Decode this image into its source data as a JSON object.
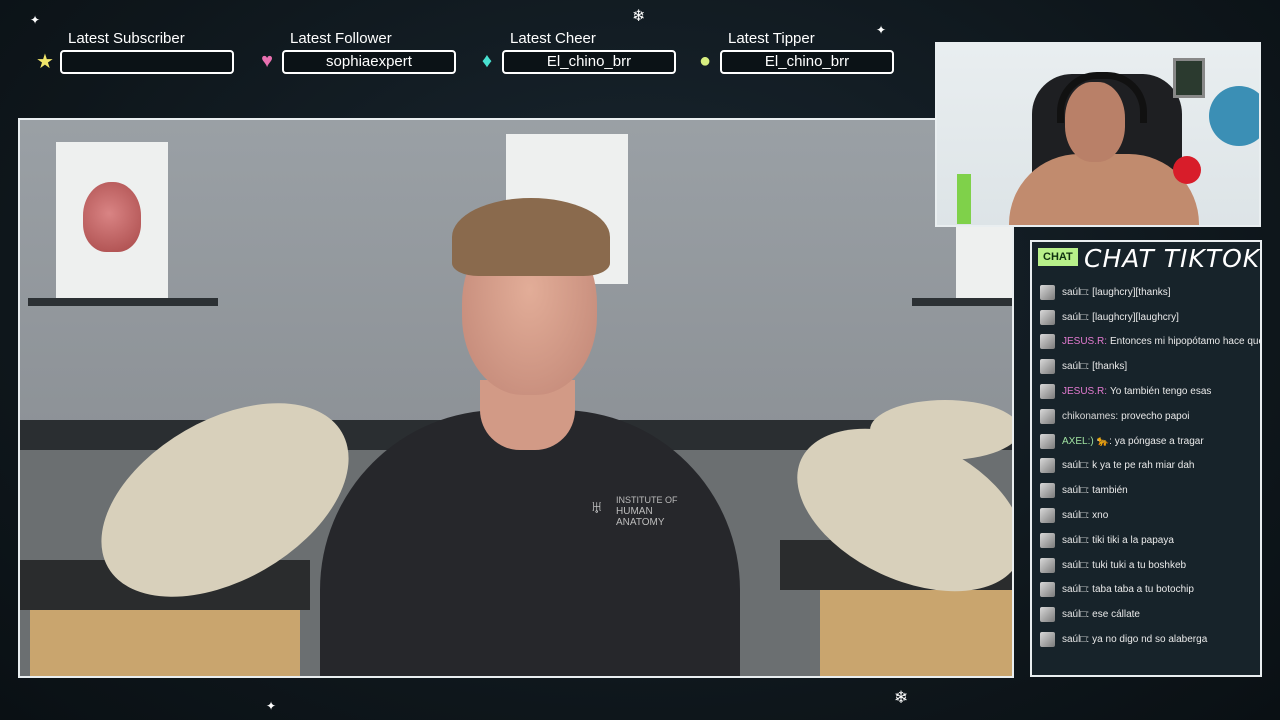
{
  "stats": [
    {
      "label": "Latest Subscriber",
      "value": "",
      "icon": "star-icon",
      "color": "#f0e56a"
    },
    {
      "label": "Latest Follower",
      "value": "sophiaexpert",
      "icon": "heart-icon",
      "color": "#e870b0"
    },
    {
      "label": "Latest Cheer",
      "value": "El_chino_brr",
      "icon": "gem-icon",
      "color": "#48e0d0"
    },
    {
      "label": "Latest Tipper",
      "value": "El_chino_brr",
      "icon": "coin-icon",
      "color": "#d8ee80"
    }
  ],
  "video": {
    "shirt_logo_line1": "INSTITUTE OF",
    "shirt_logo_line2": "HUMAN ANATOMY"
  },
  "chat": {
    "badge": "CHAT",
    "title": "CHAT TIKTOK",
    "messages": [
      {
        "user": "saúl□:",
        "text": "[laughcry][thanks]",
        "user_color": "#e6e6e6"
      },
      {
        "user": "saúl□:",
        "text": "[laughcry][laughcry]",
        "user_color": "#e6e6e6"
      },
      {
        "user": "JESUS.R:",
        "text": "Entonces mi hipopótamo hace que m",
        "user_color": "#e27ad0"
      },
      {
        "user": "saúl□:",
        "text": "[thanks]",
        "user_color": "#e6e6e6"
      },
      {
        "user": "JESUS.R:",
        "text": "Yo también tengo esas",
        "user_color": "#e27ad0"
      },
      {
        "user": "chikonames:",
        "text": "provecho papoi",
        "user_color": "#d8d8d8"
      },
      {
        "user": "AXEL:)",
        "text": "🐆: ya póngase a tragar",
        "user_color": "#9fe0a0"
      },
      {
        "user": "saúl□:",
        "text": "k ya te pe rah miar dah",
        "user_color": "#e6e6e6"
      },
      {
        "user": "saúl□:",
        "text": "también",
        "user_color": "#e6e6e6"
      },
      {
        "user": "saúl□:",
        "text": "xno",
        "user_color": "#e6e6e6"
      },
      {
        "user": "saúl□:",
        "text": "tiki tiki a la papaya",
        "user_color": "#e6e6e6"
      },
      {
        "user": "saúl□:",
        "text": "tuki tuki a tu boshkeb",
        "user_color": "#e6e6e6"
      },
      {
        "user": "saúl□:",
        "text": "taba taba a tu botochip",
        "user_color": "#e6e6e6"
      },
      {
        "user": "saúl□:",
        "text": "ese cállate",
        "user_color": "#e6e6e6"
      },
      {
        "user": "saúl□:",
        "text": "ya no digo nd so alaberga",
        "user_color": "#e6e6e6"
      }
    ]
  }
}
